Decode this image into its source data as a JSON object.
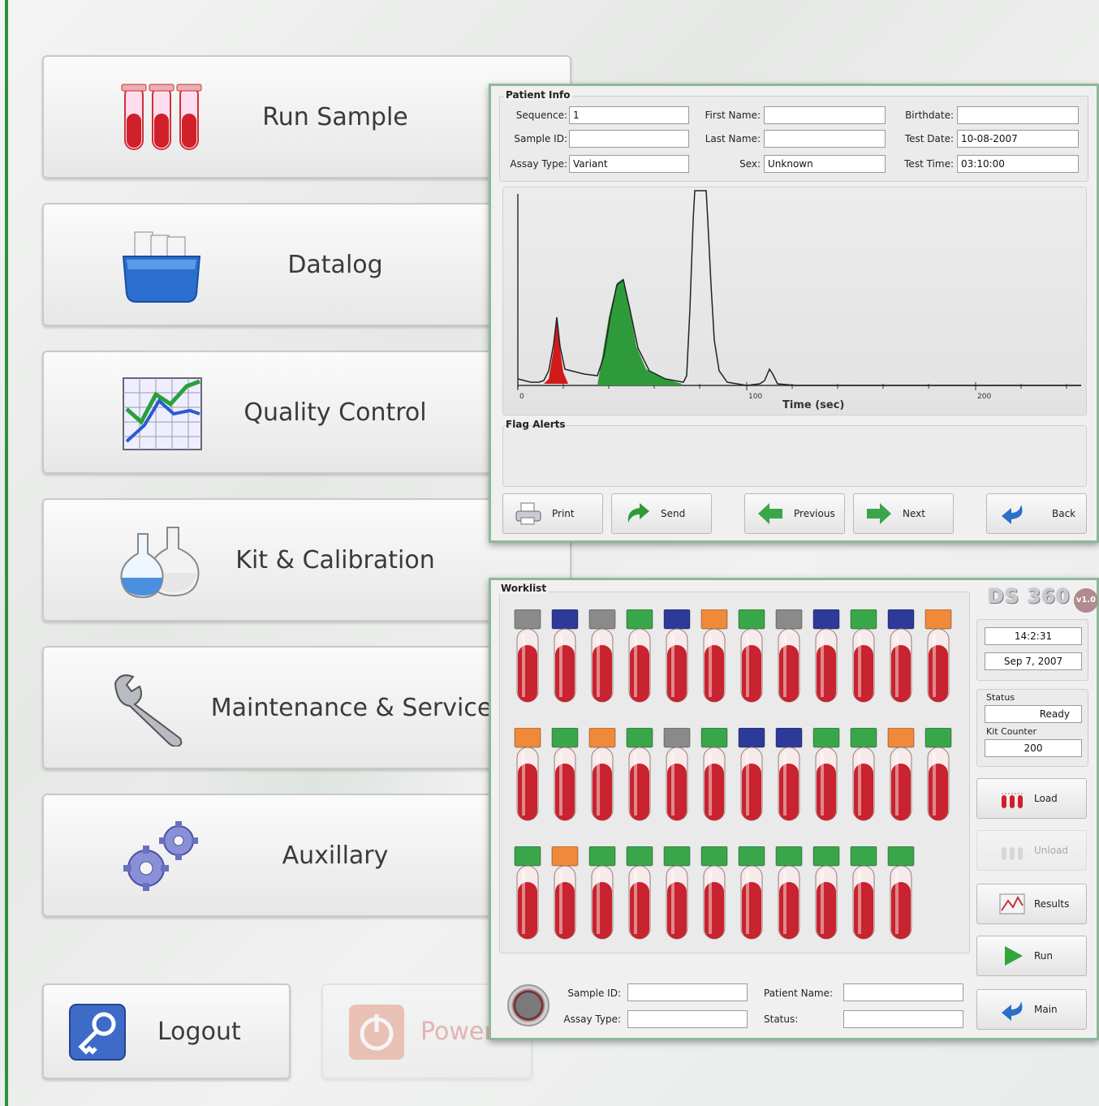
{
  "menu": {
    "run_sample": "Run Sample",
    "datalog": "Datalog",
    "quality_control": "Quality Control",
    "kit_calibration": "Kit & Calibration",
    "maintenance": "Maintenance & Service",
    "auxillary": "Auxillary",
    "logout": "Logout",
    "power": "Power"
  },
  "results_window": {
    "patient_info_legend": "Patient Info",
    "fields": {
      "sequence_label": "Sequence:",
      "sequence_value": "1",
      "sample_id_label": "Sample ID:",
      "sample_id_value": "",
      "assay_type_label": "Assay Type:",
      "assay_type_value": "Variant",
      "first_name_label": "First Name:",
      "first_name_value": "",
      "last_name_label": "Last Name:",
      "last_name_value": "",
      "sex_label": "Sex:",
      "sex_value": "Unknown",
      "birthdate_label": "Birthdate:",
      "birthdate_value": "",
      "test_date_label": "Test Date:",
      "test_date_value": "10-08-2007",
      "test_time_label": "Test Time:",
      "test_time_value": "03:10:00"
    },
    "chart_xlabel": "Time (sec)",
    "chart_ticks": [
      "0",
      "100",
      "200"
    ],
    "flag_alerts_legend": "Flag Alerts",
    "buttons": {
      "print": "Print",
      "send": "Send",
      "previous": "Previous",
      "next": "Next",
      "back": "Back"
    }
  },
  "worklist_window": {
    "legend": "Worklist",
    "brand": "DS 360",
    "version": "v1.0",
    "time": "14:2:31",
    "date": "Sep 7, 2007",
    "status_label": "Status",
    "status_value": "Ready",
    "kit_counter_label": "Kit Counter",
    "kit_counter_value": "200",
    "buttons": {
      "load": "Load",
      "unload": "Unload",
      "results": "Results",
      "run": "Run",
      "main": "Main"
    },
    "footer": {
      "sample_id_label": "Sample ID:",
      "sample_id_value": "",
      "assay_type_label": "Assay Type:",
      "assay_type_value": "",
      "patient_name_label": "Patient Name:",
      "patient_name_value": "",
      "status_label": "Status:",
      "status_value": ""
    },
    "tube_rows": [
      [
        "gray",
        "blue",
        "gray",
        "green",
        "blue",
        "orange",
        "green",
        "gray",
        "blue",
        "green",
        "blue",
        "orange"
      ],
      [
        "orange",
        "green",
        "orange",
        "green",
        "gray",
        "green",
        "blue",
        "blue",
        "green",
        "green",
        "orange",
        "green"
      ],
      [
        "green",
        "orange",
        "green",
        "green",
        "green",
        "green",
        "green",
        "green",
        "green",
        "green",
        "green"
      ]
    ]
  },
  "colors": {
    "gray": "#8a8a8a",
    "blue": "#2d3a9a",
    "green": "#3aa64a",
    "orange": "#f08a3a",
    "accent": "#2f8f3a"
  }
}
